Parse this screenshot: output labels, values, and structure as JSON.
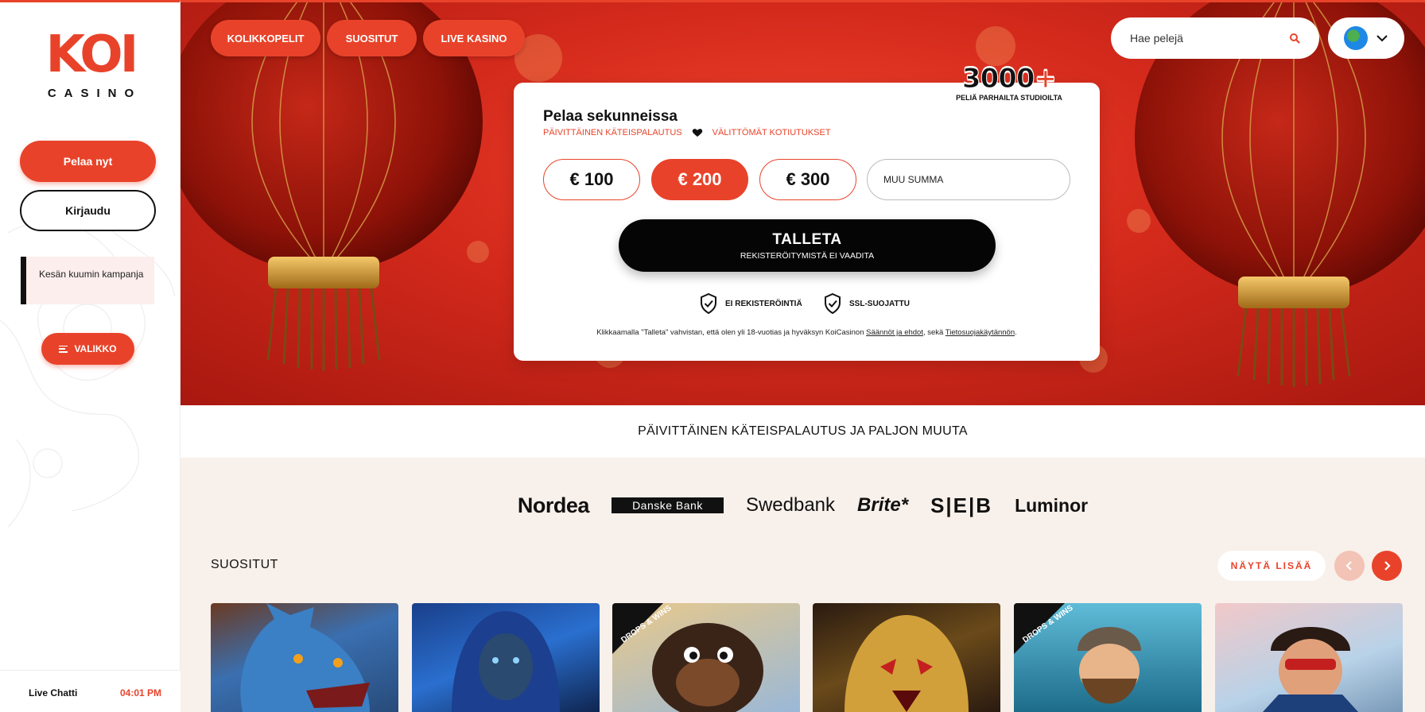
{
  "sidebar": {
    "logo_text": "KOI",
    "logo_sub": "CASINO",
    "play_label": "Pelaa nyt",
    "login_label": "Kirjaudu",
    "promo_text": "Kesän kuumin kampanja",
    "menu_label": "VALIKKO",
    "chat_label": "Live Chatti",
    "chat_time": "04:01 PM"
  },
  "nav": {
    "items": [
      {
        "label": "KOLIKKOPELIT"
      },
      {
        "label": "SUOSITUT"
      },
      {
        "label": "LIVE KASINO"
      }
    ],
    "search_placeholder": "Hae pelejä"
  },
  "deposit": {
    "title": "Pelaa sekunneissa",
    "tag1": "PÄIVITTÄINEN KÄTEISPALAUTUS",
    "tag2": "VÄLITTÖMÄT KOTIUTUKSET",
    "badge_number": "3000",
    "badge_plus": "+",
    "badge_text": "PELIÄ PARHAILTA STUDIOILTA",
    "amounts": [
      "€ 100",
      "€ 200",
      "€ 300"
    ],
    "selected_amount": "€ 200",
    "other_placeholder": "MUU SUMMA",
    "button_label": "TALLETA",
    "button_sub": "REKISTERÖITYMISTÄ EI VAADITA",
    "trust1": "EI REKISTERÖINTIÄ",
    "trust2": "SSL-SUOJATTU",
    "terms_pre": "Klikkaamalla \"Talleta\" vahvistan, että olen yli 18-vuotias ja hyväksyn KoiCasinon ",
    "terms_link1": "Säännöt ja ehdot",
    "terms_mid": ", sekä ",
    "terms_link2": "Tietosuojakäytännön",
    "terms_end": "."
  },
  "cashback_banner": "PÄIVITTÄINEN KÄTEISPALAUTUS JA PALJON MUUTA",
  "banks": [
    "Nordea",
    "Danske Bank",
    "Swedbank",
    "Brite*",
    "S|E|B",
    "Luminor"
  ],
  "popular": {
    "title": "SUOSITUT",
    "show_more": "NÄYTÄ LISÄÄ",
    "drops_label": "DROPS & WINS"
  },
  "colors": {
    "accent": "#e8432a",
    "dark": "#111111",
    "bg": "#f8f0ea"
  }
}
